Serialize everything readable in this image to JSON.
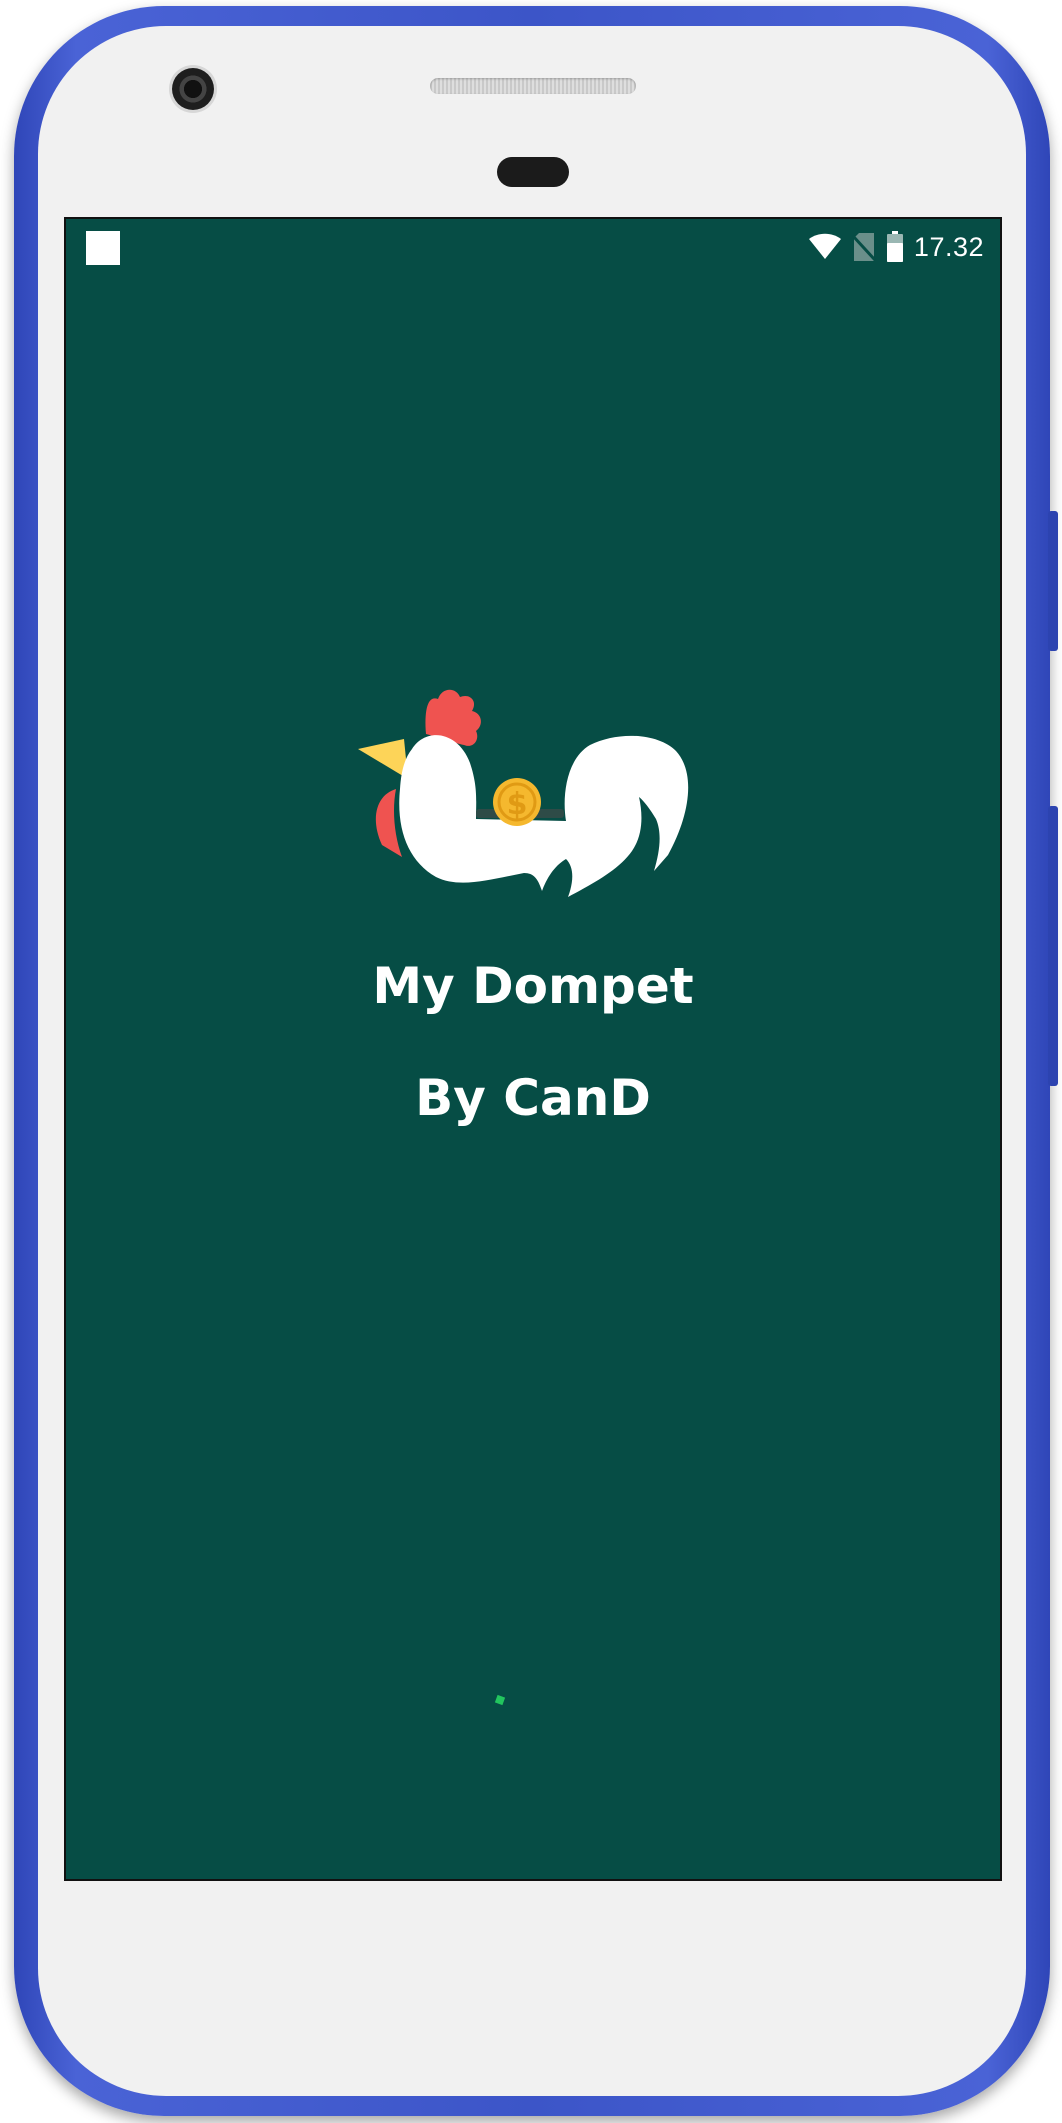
{
  "status_bar": {
    "time": "17.32",
    "icons": [
      "notification-square-icon",
      "wifi-icon",
      "no-sim-icon",
      "battery-icon"
    ]
  },
  "splash": {
    "logo": "rooster-piggy-bank-logo",
    "title": "My Dompet",
    "subtitle": "By CanD"
  },
  "colors": {
    "background": "#064d45",
    "text": "#ffffff",
    "comb": "#ef5350",
    "beak": "#fdd458",
    "coin": "#f5b82e",
    "loader": "#22c55e",
    "device_frame": "#3c55c8"
  }
}
